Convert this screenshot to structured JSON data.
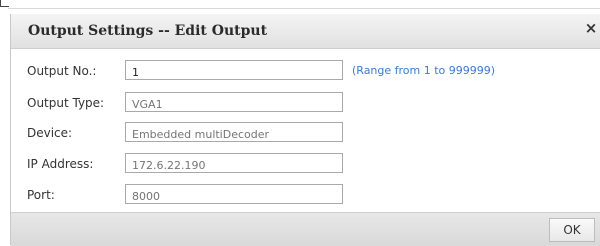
{
  "dialog": {
    "title": "Output Settings -- Edit Output",
    "close_glyph": "×",
    "fields": [
      {
        "label": "Output No.:",
        "value": "1",
        "placeholder": "",
        "disabled": false,
        "hint": "(Range from 1 to 999999)"
      },
      {
        "label": "Output Type:",
        "value": "",
        "placeholder": "VGA1",
        "disabled": true,
        "hint": ""
      },
      {
        "label": "Device:",
        "value": "",
        "placeholder": "Embedded multiDecoder",
        "disabled": true,
        "hint": ""
      },
      {
        "label": "IP Address:",
        "value": "",
        "placeholder": "172.6.22.190",
        "disabled": true,
        "hint": ""
      },
      {
        "label": "Port:",
        "value": "",
        "placeholder": "8000",
        "disabled": true,
        "hint": ""
      }
    ],
    "ok_label": "OK"
  },
  "colors": {
    "hint": "#3a7bd5",
    "header_bg": "#e1e1e1",
    "footer_bg": "#d9d9d9"
  },
  "icons": {
    "close": "close-icon"
  }
}
